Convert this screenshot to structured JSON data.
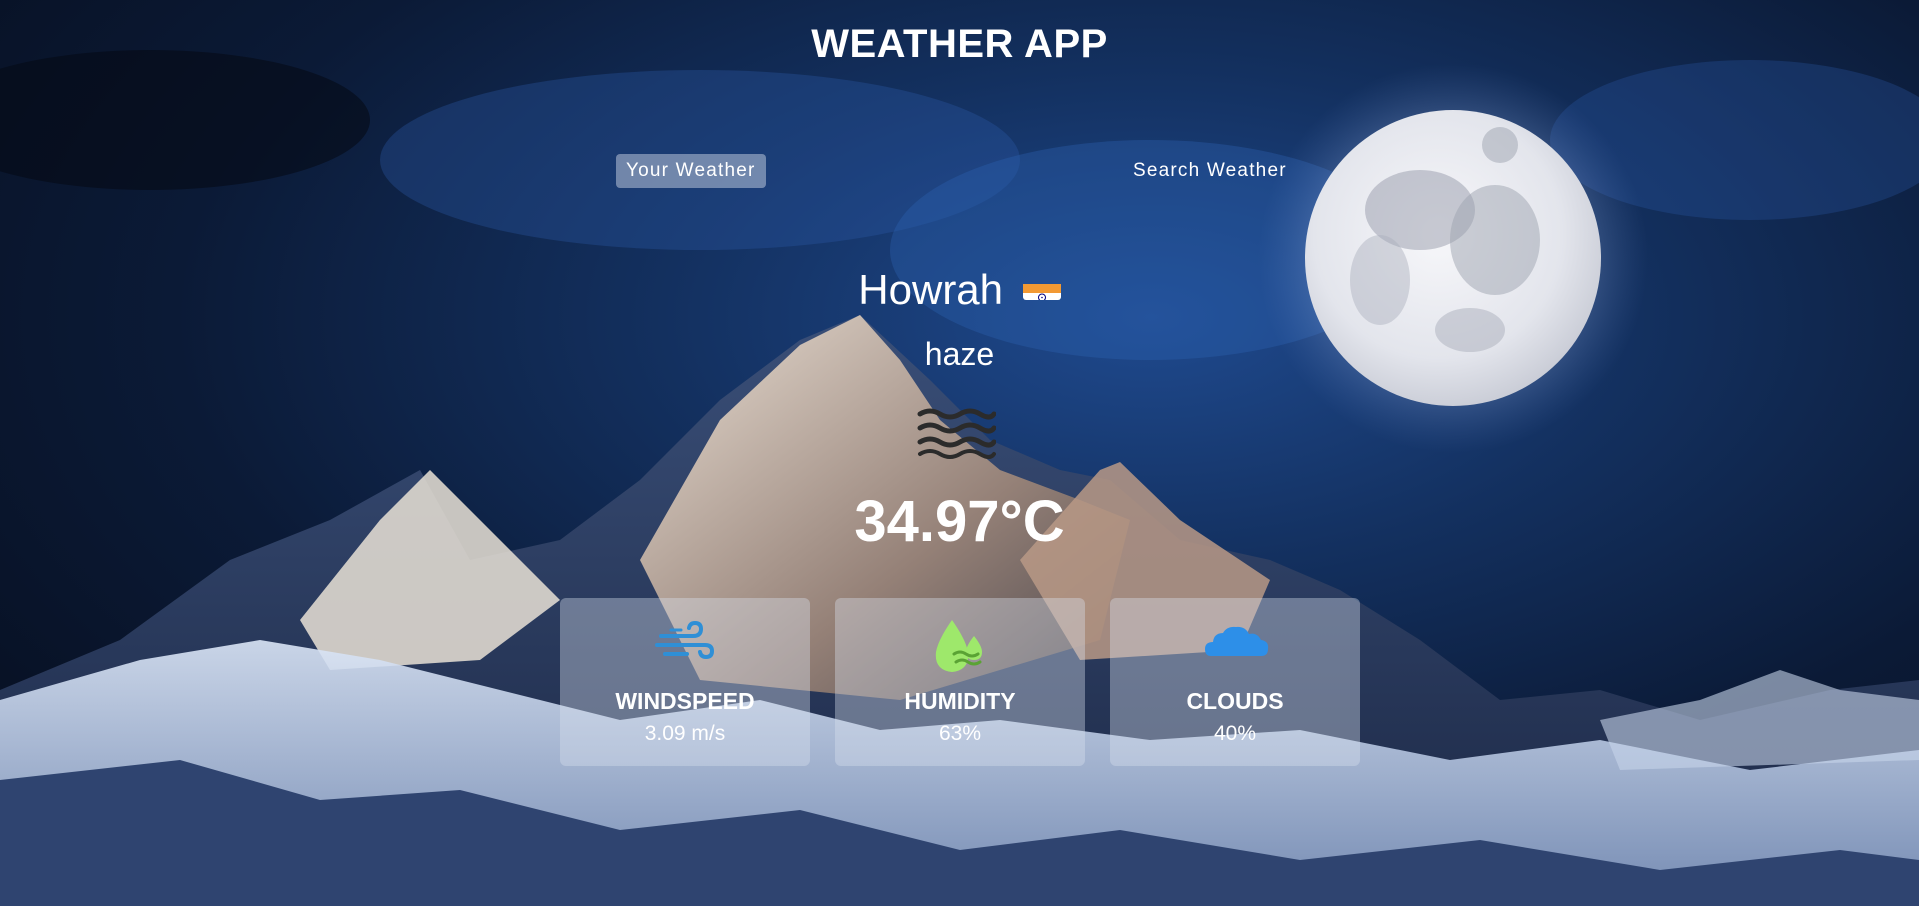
{
  "app": {
    "title": "WEATHER APP"
  },
  "tabs": [
    {
      "label": "Your Weather",
      "active": true
    },
    {
      "label": "Search Weather",
      "active": false
    }
  ],
  "weather": {
    "city": "Howrah",
    "country_flag_icon": "india-flag-icon",
    "description": "haze",
    "condition_icon": "haze-icon",
    "temperature": "34.97°C"
  },
  "stats": [
    {
      "label": "WINDSPEED",
      "value": "3.09 m/s",
      "icon": "wind-icon",
      "color": "#2f8fd6"
    },
    {
      "label": "HUMIDITY",
      "value": "63%",
      "icon": "humidity-icon",
      "color": "#9ee86b"
    },
    {
      "label": "CLOUDS",
      "value": "40%",
      "icon": "cloud-icon",
      "color": "#2d8fe8"
    }
  ]
}
